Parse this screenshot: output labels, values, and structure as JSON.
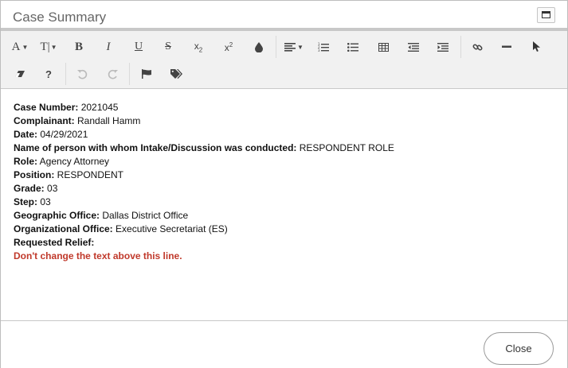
{
  "dialog": {
    "title": "Case Summary",
    "maximize_icon": "window-maximize-icon"
  },
  "toolbar": {
    "row1": [
      {
        "name": "font-family-dropdown",
        "label": "A",
        "icon": "font-family-icon"
      },
      {
        "name": "font-size-dropdown",
        "label": "T|",
        "icon": "font-size-icon"
      },
      {
        "name": "bold-button",
        "label": "B",
        "icon": "bold-icon"
      },
      {
        "name": "italic-button",
        "label": "I",
        "icon": "italic-icon"
      },
      {
        "name": "underline-button",
        "label": "U",
        "icon": "underline-icon"
      },
      {
        "name": "strikethrough-button",
        "label": "S",
        "icon": "strikethrough-icon"
      },
      {
        "name": "subscript-button",
        "label": "x₂",
        "icon": "subscript-icon"
      },
      {
        "name": "superscript-button",
        "label": "x²",
        "icon": "superscript-icon"
      },
      {
        "name": "text-color-button",
        "icon": "droplet-icon"
      },
      {
        "name": "align-dropdown",
        "icon": "align-left-icon"
      },
      {
        "name": "ordered-list-button",
        "icon": "ordered-list-icon"
      },
      {
        "name": "unordered-list-button",
        "icon": "unordered-list-icon"
      },
      {
        "name": "table-button",
        "icon": "table-icon"
      },
      {
        "name": "outdent-button",
        "icon": "outdent-icon"
      },
      {
        "name": "indent-button",
        "icon": "indent-icon"
      },
      {
        "name": "link-button",
        "icon": "link-icon"
      },
      {
        "name": "horizontal-rule-button",
        "icon": "horizontal-rule-icon"
      },
      {
        "name": "select-button",
        "icon": "cursor-pointer-icon"
      }
    ],
    "row2": [
      {
        "name": "clear-format-button",
        "icon": "eraser-icon"
      },
      {
        "name": "help-button",
        "label": "?",
        "icon": "help-icon"
      },
      {
        "name": "undo-button",
        "icon": "undo-icon",
        "disabled": true
      },
      {
        "name": "redo-button",
        "icon": "redo-icon",
        "disabled": true
      },
      {
        "name": "flag-button",
        "icon": "flag-icon"
      },
      {
        "name": "tags-button",
        "icon": "tags-icon"
      }
    ]
  },
  "content": {
    "fields": [
      {
        "label": "Case Number:",
        "value": " 2021045"
      },
      {
        "label": "Complainant:",
        "value": " Randall Hamm"
      },
      {
        "label": "Date:",
        "value": " 04/29/2021"
      },
      {
        "label": "Name of person with whom Intake/Discussion was conducted:",
        "value": " RESPONDENT ROLE"
      },
      {
        "label": "Role:",
        "value": " Agency Attorney"
      },
      {
        "label": "Position:",
        "value": " RESPONDENT"
      },
      {
        "label": "Grade:",
        "value": " 03"
      },
      {
        "label": "Step:",
        "value": " 03"
      },
      {
        "label": "Geographic Office:",
        "value": " Dallas District Office"
      },
      {
        "label": "Organizational Office:",
        "value": " Executive Secretariat (ES)"
      },
      {
        "label": "Requested Relief:",
        "value": ""
      }
    ],
    "warning": "Don't change the text above this line.",
    "warning_color": "#c0392b"
  },
  "footer": {
    "close_label": "Close"
  }
}
